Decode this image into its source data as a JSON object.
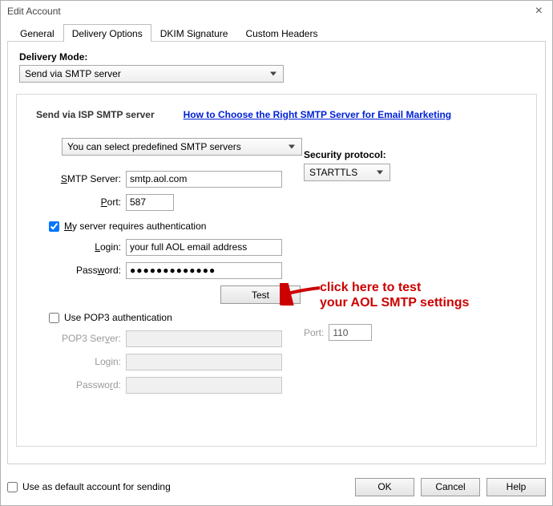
{
  "window": {
    "title": "Edit Account"
  },
  "tabs": {
    "general": "General",
    "delivery": "Delivery Options",
    "dkim": "DKIM Signature",
    "custom": "Custom Headers"
  },
  "delivery": {
    "mode_label": "Delivery Mode:",
    "mode_selected": "Send via SMTP server"
  },
  "smtp": {
    "section_title": "Send via ISP SMTP server",
    "help_link": "How to Choose the Right SMTP Server for Email Marketing",
    "predef_selected": "You can select predefined SMTP servers",
    "server_label_leading": "S",
    "server_label_rest": "MTP Server:",
    "server_value": "smtp.aol.com",
    "port_label_leading": "P",
    "port_label_rest": "ort:",
    "port_value": "587",
    "security_label": "Security protocol:",
    "security_selected": "STARTTLS",
    "auth_required_label_leading": "M",
    "auth_required_label_rest": "y server requires authentication",
    "auth_required_checked": true,
    "login_label_leading": "L",
    "login_label_rest": "ogin:",
    "login_value": "your full AOL email address",
    "password_label": "Pass",
    "password_label_u": "w",
    "password_label_rest": "ord:",
    "password_value": "●●●●●●●●●●●●●",
    "test_label": "Test"
  },
  "pop3": {
    "use_label": "Use POP3 authentication",
    "use_checked": false,
    "server_label": "POP3 Ser",
    "server_label_u": "v",
    "server_label_rest": "er:",
    "server_value": "",
    "login_label": "Lo",
    "login_label_u": "g",
    "login_label_rest": "in:",
    "login_value": "",
    "password_label": "Passwo",
    "password_label_u": "r",
    "password_label_rest": "d:",
    "password_value": "",
    "port_label": "Port:",
    "port_value": "110"
  },
  "annotation": {
    "line1": "click here to test",
    "line2": "your AOL SMTP settings"
  },
  "footer": {
    "default_label": "Use as default account for sending",
    "default_checked": false,
    "ok": "OK",
    "cancel": "Cancel",
    "help": "Help"
  }
}
